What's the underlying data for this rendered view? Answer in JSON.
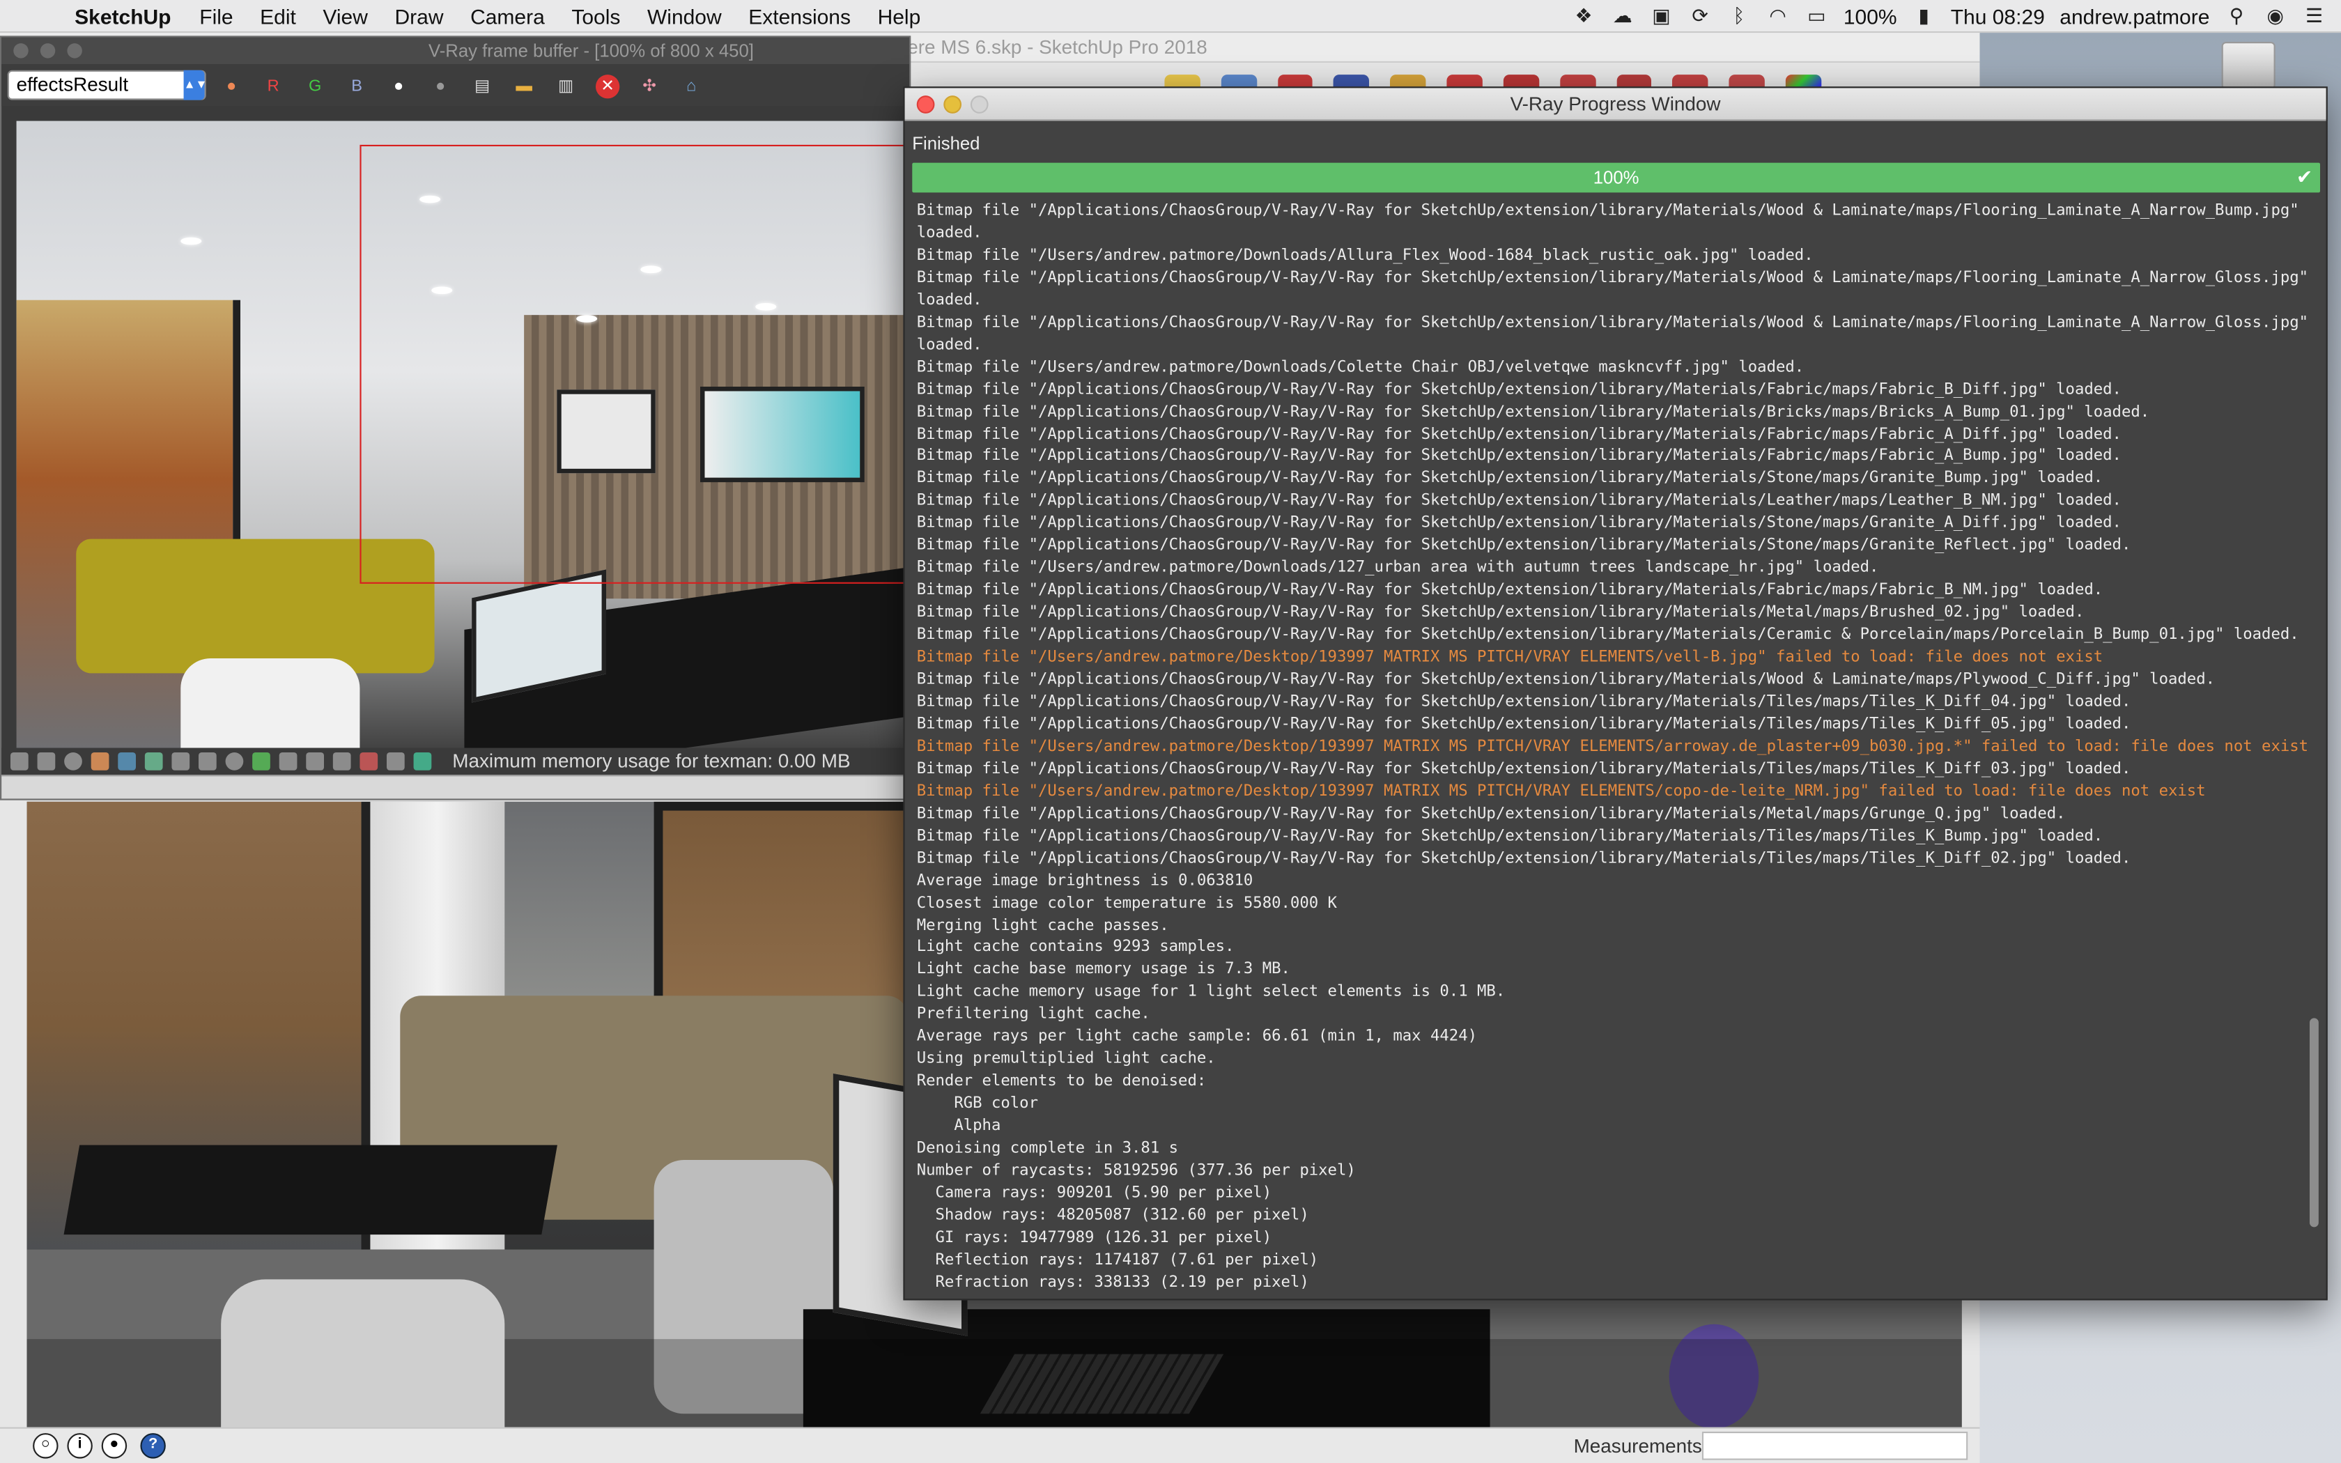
{
  "menubar": {
    "app": "SketchUp",
    "items": [
      "File",
      "Edit",
      "View",
      "Draw",
      "Camera",
      "Tools",
      "Window",
      "Extensions",
      "Help"
    ],
    "battery": "100%",
    "clock": "Thu 08:29",
    "user": "andrew.patmore"
  },
  "sketchup": {
    "title": "194900 Kingsmere MS 6.skp - SketchUp Pro 2018",
    "measurements_label": "Measurements",
    "measurements_value": ""
  },
  "vfb": {
    "title": "V-Ray frame buffer - [100% of 800 x 450]",
    "channel": "effectsResult",
    "channel_buttons": [
      "R",
      "G",
      "B"
    ],
    "status": "Maximum memory usage for texman: 0.00 MB"
  },
  "progress": {
    "title": "V-Ray Progress Window",
    "state": "Finished",
    "percent": "100%",
    "percent_value": 1.0,
    "check": "✔",
    "accent": "#5fbf6a",
    "warning_color": "#e68a3f",
    "log": [
      {
        "t": "Bitmap file \"/Applications/ChaosGroup/V-Ray/V-Ray for SketchUp/extension/library/Materials/Wood & Laminate/maps/Flooring_Laminate_A_Narrow_Bump.jpg\"",
        "w": false
      },
      {
        "t": "loaded.",
        "w": false
      },
      {
        "t": "Bitmap file \"/Users/andrew.patmore/Downloads/Allura_Flex_Wood-1684_black_rustic_oak.jpg\" loaded.",
        "w": false
      },
      {
        "t": "Bitmap file \"/Applications/ChaosGroup/V-Ray/V-Ray for SketchUp/extension/library/Materials/Wood & Laminate/maps/Flooring_Laminate_A_Narrow_Gloss.jpg\"",
        "w": false
      },
      {
        "t": "loaded.",
        "w": false
      },
      {
        "t": "Bitmap file \"/Applications/ChaosGroup/V-Ray/V-Ray for SketchUp/extension/library/Materials/Wood & Laminate/maps/Flooring_Laminate_A_Narrow_Gloss.jpg\"",
        "w": false
      },
      {
        "t": "loaded.",
        "w": false
      },
      {
        "t": "Bitmap file \"/Users/andrew.patmore/Downloads/Colette Chair OBJ/velvetqwe maskncvff.jpg\" loaded.",
        "w": false
      },
      {
        "t": "Bitmap file \"/Applications/ChaosGroup/V-Ray/V-Ray for SketchUp/extension/library/Materials/Fabric/maps/Fabric_B_Diff.jpg\" loaded.",
        "w": false
      },
      {
        "t": "Bitmap file \"/Applications/ChaosGroup/V-Ray/V-Ray for SketchUp/extension/library/Materials/Bricks/maps/Bricks_A_Bump_01.jpg\" loaded.",
        "w": false
      },
      {
        "t": "Bitmap file \"/Applications/ChaosGroup/V-Ray/V-Ray for SketchUp/extension/library/Materials/Fabric/maps/Fabric_A_Diff.jpg\" loaded.",
        "w": false
      },
      {
        "t": "Bitmap file \"/Applications/ChaosGroup/V-Ray/V-Ray for SketchUp/extension/library/Materials/Fabric/maps/Fabric_A_Bump.jpg\" loaded.",
        "w": false
      },
      {
        "t": "Bitmap file \"/Applications/ChaosGroup/V-Ray/V-Ray for SketchUp/extension/library/Materials/Stone/maps/Granite_Bump.jpg\" loaded.",
        "w": false
      },
      {
        "t": "Bitmap file \"/Applications/ChaosGroup/V-Ray/V-Ray for SketchUp/extension/library/Materials/Leather/maps/Leather_B_NM.jpg\" loaded.",
        "w": false
      },
      {
        "t": "Bitmap file \"/Applications/ChaosGroup/V-Ray/V-Ray for SketchUp/extension/library/Materials/Stone/maps/Granite_A_Diff.jpg\" loaded.",
        "w": false
      },
      {
        "t": "Bitmap file \"/Applications/ChaosGroup/V-Ray/V-Ray for SketchUp/extension/library/Materials/Stone/maps/Granite_Reflect.jpg\" loaded.",
        "w": false
      },
      {
        "t": "Bitmap file \"/Users/andrew.patmore/Downloads/127_urban area with autumn trees landscape_hr.jpg\" loaded.",
        "w": false
      },
      {
        "t": "Bitmap file \"/Applications/ChaosGroup/V-Ray/V-Ray for SketchUp/extension/library/Materials/Fabric/maps/Fabric_B_NM.jpg\" loaded.",
        "w": false
      },
      {
        "t": "Bitmap file \"/Applications/ChaosGroup/V-Ray/V-Ray for SketchUp/extension/library/Materials/Metal/maps/Brushed_02.jpg\" loaded.",
        "w": false
      },
      {
        "t": "Bitmap file \"/Applications/ChaosGroup/V-Ray/V-Ray for SketchUp/extension/library/Materials/Ceramic & Porcelain/maps/Porcelain_B_Bump_01.jpg\" loaded.",
        "w": false
      },
      {
        "t": "Bitmap file \"/Users/andrew.patmore/Desktop/193997 MATRIX MS PITCH/VRAY ELEMENTS/vell-B.jpg\" failed to load: file does not exist",
        "w": true
      },
      {
        "t": "Bitmap file \"/Applications/ChaosGroup/V-Ray/V-Ray for SketchUp/extension/library/Materials/Wood & Laminate/maps/Plywood_C_Diff.jpg\" loaded.",
        "w": false
      },
      {
        "t": "Bitmap file \"/Applications/ChaosGroup/V-Ray/V-Ray for SketchUp/extension/library/Materials/Tiles/maps/Tiles_K_Diff_04.jpg\" loaded.",
        "w": false
      },
      {
        "t": "Bitmap file \"/Applications/ChaosGroup/V-Ray/V-Ray for SketchUp/extension/library/Materials/Tiles/maps/Tiles_K_Diff_05.jpg\" loaded.",
        "w": false
      },
      {
        "t": "Bitmap file \"/Users/andrew.patmore/Desktop/193997 MATRIX MS PITCH/VRAY ELEMENTS/arroway.de_plaster+09_b030.jpg.*\" failed to load: file does not exist",
        "w": true
      },
      {
        "t": "Bitmap file \"/Applications/ChaosGroup/V-Ray/V-Ray for SketchUp/extension/library/Materials/Tiles/maps/Tiles_K_Diff_03.jpg\" loaded.",
        "w": false
      },
      {
        "t": "Bitmap file \"/Users/andrew.patmore/Desktop/193997 MATRIX MS PITCH/VRAY ELEMENTS/copo-de-leite_NRM.jpg\" failed to load: file does not exist",
        "w": true
      },
      {
        "t": "Bitmap file \"/Applications/ChaosGroup/V-Ray/V-Ray for SketchUp/extension/library/Materials/Metal/maps/Grunge_Q.jpg\" loaded.",
        "w": false
      },
      {
        "t": "Bitmap file \"/Applications/ChaosGroup/V-Ray/V-Ray for SketchUp/extension/library/Materials/Tiles/maps/Tiles_K_Bump.jpg\" loaded.",
        "w": false
      },
      {
        "t": "Bitmap file \"/Applications/ChaosGroup/V-Ray/V-Ray for SketchUp/extension/library/Materials/Tiles/maps/Tiles_K_Diff_02.jpg\" loaded.",
        "w": false
      },
      {
        "t": "Average image brightness is 0.063810",
        "w": false
      },
      {
        "t": "Closest image color temperature is 5580.000 K",
        "w": false
      },
      {
        "t": "Merging light cache passes.",
        "w": false
      },
      {
        "t": "Light cache contains 9293 samples.",
        "w": false
      },
      {
        "t": "Light cache base memory usage is 7.3 MB.",
        "w": false
      },
      {
        "t": "Light cache memory usage for 1 light select elements is 0.1 MB.",
        "w": false
      },
      {
        "t": "Prefiltering light cache.",
        "w": false
      },
      {
        "t": "Average rays per light cache sample: 66.61 (min 1, max 4424)",
        "w": false
      },
      {
        "t": "Using premultiplied light cache.",
        "w": false
      },
      {
        "t": "Render elements to be denoised:",
        "w": false
      },
      {
        "t": "    RGB color",
        "w": false
      },
      {
        "t": "    Alpha",
        "w": false
      },
      {
        "t": "Denoising complete in 3.81 s",
        "w": false
      },
      {
        "t": "Number of raycasts: 58192596 (377.36 per pixel)",
        "w": false
      },
      {
        "t": "  Camera rays: 909201 (5.90 per pixel)",
        "w": false
      },
      {
        "t": "  Shadow rays: 48205087 (312.60 per pixel)",
        "w": false
      },
      {
        "t": "  GI rays: 19477989 (126.31 per pixel)",
        "w": false
      },
      {
        "t": "  Reflection rays: 1174187 (7.61 per pixel)",
        "w": false
      },
      {
        "t": "  Refraction rays: 338133 (2.19 per pixel)",
        "w": false
      }
    ]
  }
}
